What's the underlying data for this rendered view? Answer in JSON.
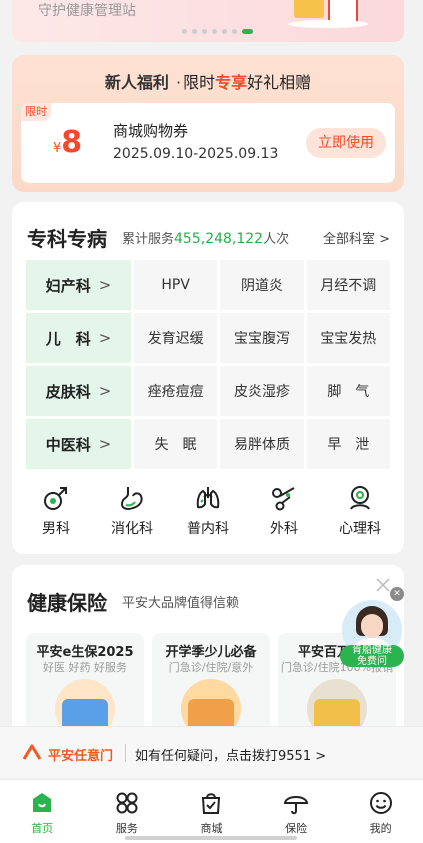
{
  "banner": {
    "text": "守护健康管理站",
    "page_count": 7,
    "active_index": 6
  },
  "new_user": {
    "title": "新人福利",
    "separator": "·",
    "sub_pre": "限时",
    "sub_highlight": "专享",
    "sub_post": "好礼相赠",
    "coupon": {
      "tag": "限时",
      "currency": "¥",
      "amount": "8",
      "name": "商城购物券",
      "date_range": "2025.09.10-2025.09.13",
      "button": "立即使用"
    }
  },
  "specialty": {
    "title": "专科专病",
    "count_prefix": "累计服务",
    "count_value": "455,248,122",
    "count_suffix": "人次",
    "all_link": "全部科室 >",
    "rows": [
      {
        "dept": "妇产科",
        "items": [
          "HPV",
          "阴道炎",
          "月经不调"
        ]
      },
      {
        "dept": "儿　科",
        "items": [
          "发育迟缓",
          "宝宝腹泻",
          "宝宝发热"
        ]
      },
      {
        "dept": "皮肤科",
        "items": [
          "痤疮痘痘",
          "皮炎湿疹",
          "脚　气"
        ]
      },
      {
        "dept": "中医科",
        "items": [
          "失　眠",
          "易胖体质",
          "早　泄"
        ]
      }
    ],
    "chevron": ">",
    "icons": [
      {
        "label": "男科",
        "icon": "male-icon"
      },
      {
        "label": "消化科",
        "icon": "stomach-icon"
      },
      {
        "label": "普内科",
        "icon": "lungs-icon"
      },
      {
        "label": "外科",
        "icon": "scissors-icon"
      },
      {
        "label": "心理科",
        "icon": "mind-icon"
      }
    ]
  },
  "insurance": {
    "title": "健康保险",
    "subtitle": "平安大品牌值得信赖",
    "cards": [
      {
        "title": "平安e生保2025",
        "sub": "好医 好药 好服务"
      },
      {
        "title": "开学季少儿必备",
        "sub": "门急诊/住院/意外"
      },
      {
        "title": "平安百万医疗",
        "sub": "门急诊/住院100%报销"
      }
    ]
  },
  "float_badge": {
    "line1": "肯船健康",
    "line2": "免费问"
  },
  "service_bar": {
    "brand": "平安任意门",
    "hint": "如有任何疑问，点击拨打9551 >"
  },
  "tabs": [
    {
      "label": "首页",
      "icon": "home-icon",
      "active": true
    },
    {
      "label": "服务",
      "icon": "grid-icon",
      "active": false
    },
    {
      "label": "商城",
      "icon": "shopping-bag-icon",
      "active": false
    },
    {
      "label": "保险",
      "icon": "umbrella-icon",
      "active": false
    },
    {
      "label": "我的",
      "icon": "smiley-icon",
      "active": false
    }
  ],
  "colors": {
    "brand_green": "#2cb24e",
    "accent_red": "#f24a2c",
    "brand_orange": "#f05a22"
  }
}
